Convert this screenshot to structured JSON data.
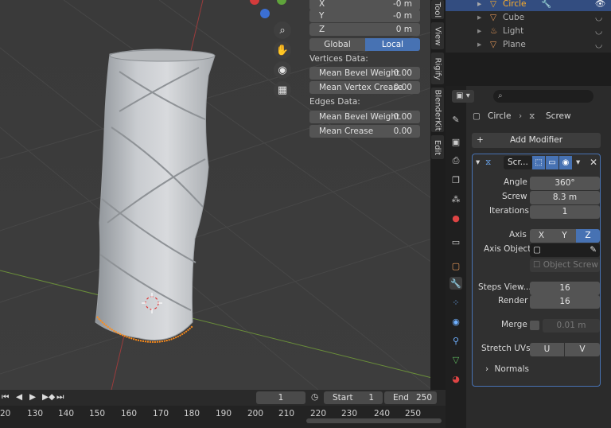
{
  "transform": {
    "x": {
      "label": "X",
      "value": "-0 m"
    },
    "y": {
      "label": "Y",
      "value": "-0 m"
    },
    "z": {
      "label": "Z",
      "value": "0 m"
    },
    "space_global": "Global",
    "space_local": "Local",
    "vertices_label": "Vertices Data:",
    "mean_bevel_weight_v": {
      "label": "Mean Bevel Weight",
      "value": "0.00"
    },
    "mean_vertex_crease": {
      "label": "Mean Vertex Crease",
      "value": "0.00"
    },
    "edges_label": "Edges Data:",
    "mean_bevel_weight_e": {
      "label": "Mean Bevel Weight",
      "value": "0.00"
    },
    "mean_crease": {
      "label": "Mean Crease",
      "value": "0.00"
    }
  },
  "side_tabs": [
    "Tool",
    "View",
    "Rigify",
    "BlenderKit",
    "Edit"
  ],
  "outliner": {
    "items": [
      {
        "name": "Circle"
      },
      {
        "name": "Cube"
      },
      {
        "name": "Light"
      },
      {
        "name": "Plane"
      }
    ]
  },
  "properties": {
    "breadcrumb_object": "Circle",
    "breadcrumb_modifier": "Screw",
    "add_modifier": "Add Modifier",
    "modifier_name": "Scr...",
    "angle": {
      "label": "Angle",
      "value": "360°"
    },
    "screw": {
      "label": "Screw",
      "value": "8.3 m"
    },
    "iterations": {
      "label": "Iterations",
      "value": "1"
    },
    "axis": {
      "label": "Axis",
      "options": [
        "X",
        "Y",
        "Z"
      ],
      "selected": "Z"
    },
    "axis_object": {
      "label": "Axis Object"
    },
    "object_screw": "Object Screw",
    "steps_viewport": {
      "label": "Steps View...",
      "value": "16"
    },
    "render": {
      "label": "Render",
      "value": "16"
    },
    "merge": {
      "label": "Merge",
      "value": "0.01 m"
    },
    "stretch_uvs": {
      "label": "Stretch UVs",
      "options": [
        "U",
        "V"
      ]
    },
    "normals": "Normals"
  },
  "timeline": {
    "current_frame": "1",
    "start_label": "Start",
    "start_value": "1",
    "end_label": "End",
    "end_value": "250",
    "ruler": [
      "20",
      "130",
      "140",
      "150",
      "160",
      "170",
      "180",
      "190",
      "200",
      "210",
      "220",
      "230",
      "240",
      "250"
    ]
  },
  "colors": {
    "accent": "#4772b3",
    "selected_object": "#ffaf29",
    "viewport_bg": "#3d3d3d"
  }
}
